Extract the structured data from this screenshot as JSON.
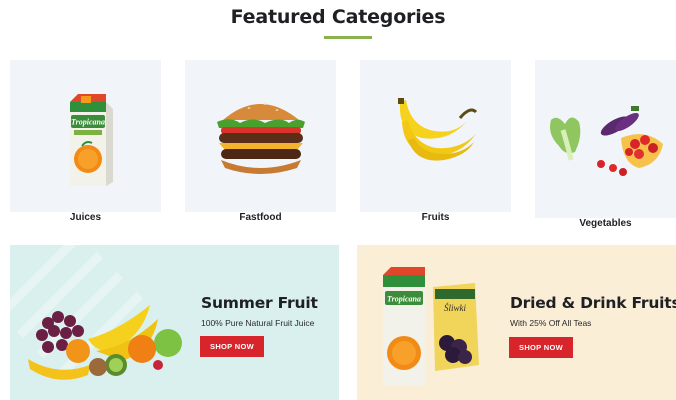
{
  "section": {
    "title": "Featured Categories"
  },
  "categories": [
    {
      "label": "Juices",
      "image": "juice-carton-image"
    },
    {
      "label": "Fastfood",
      "image": "burger-image"
    },
    {
      "label": "Fruits",
      "image": "banana-image"
    },
    {
      "label": "Vegetables",
      "image": "vegetables-bowl-image"
    }
  ],
  "banners": [
    {
      "title": "Summer Fruit",
      "subtitle": "100% Pure Natural Fruit Juice",
      "button": "SHOP NOW",
      "background": "#d9f0ee"
    },
    {
      "title": "Dried & Drink Fruits",
      "subtitle": "With 25% Off All Teas",
      "button": "SHOP NOW",
      "background": "#fbeed6"
    }
  ],
  "product_text": {
    "brand": "Tropicana",
    "pouch_label": "Śliwki"
  },
  "colors": {
    "accent_underline": "#8bb14e",
    "button_red": "#d7252b",
    "tile_bg": "#f1f4f8"
  }
}
